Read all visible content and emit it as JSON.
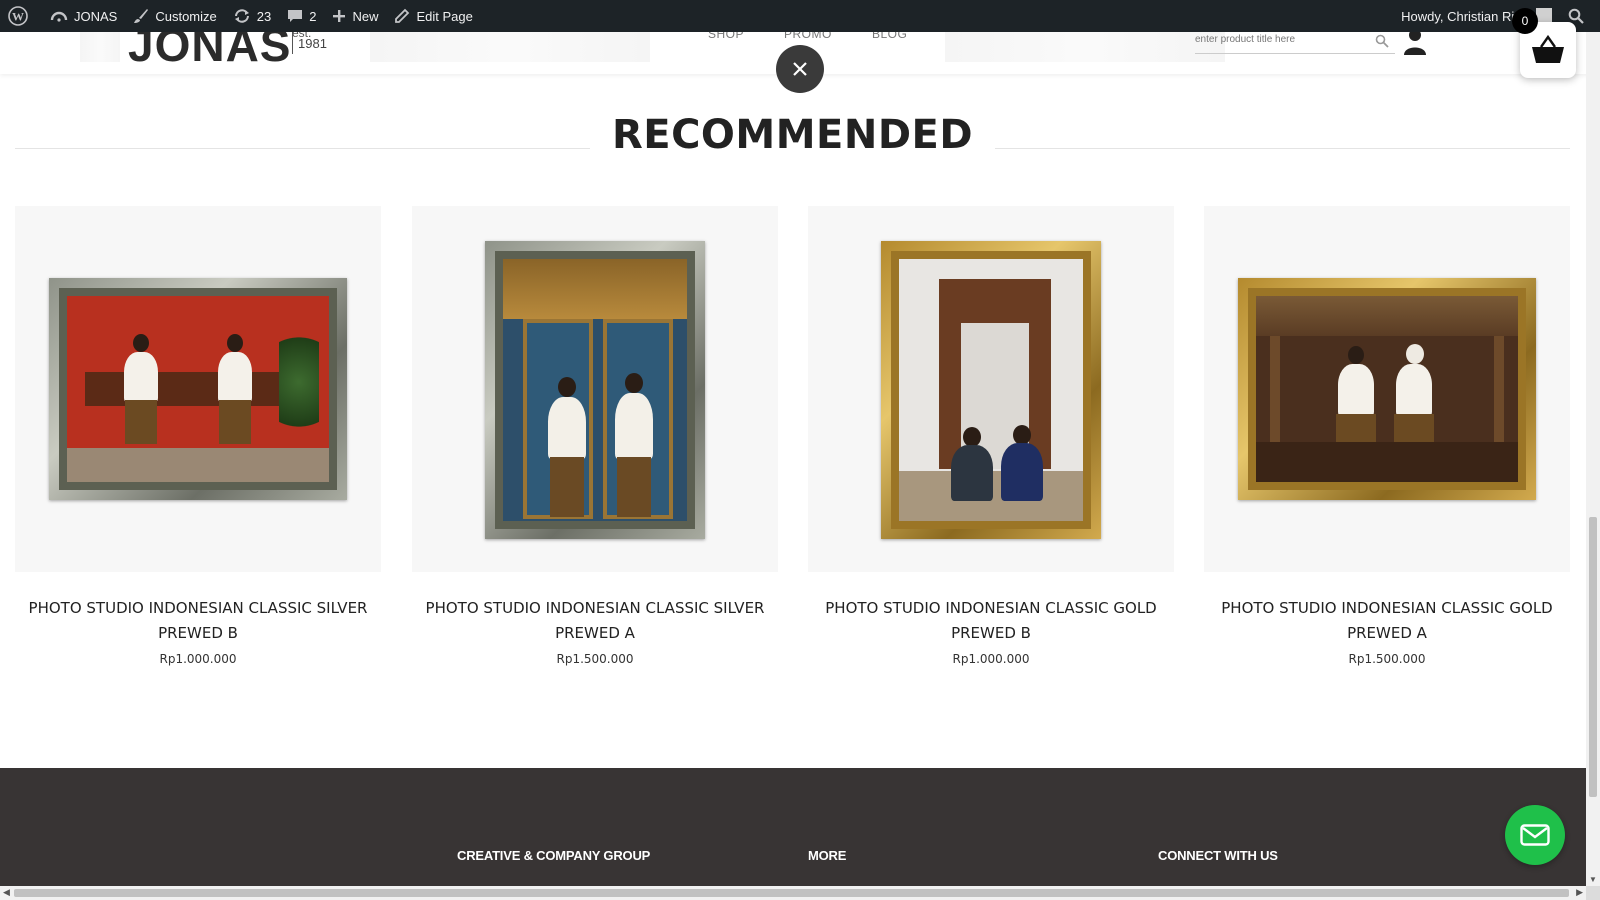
{
  "adminbar": {
    "site_name": "JONAS",
    "customize": "Customize",
    "updates_count": "23",
    "comments_count": "2",
    "new_label": "New",
    "edit_page": "Edit Page",
    "howdy": "Howdy, Christian Riza"
  },
  "header": {
    "logo_text": "JONAS",
    "logo_est": "est.",
    "logo_year": "1981",
    "nav": [
      "SHOP",
      "PROMO",
      "BLOG"
    ],
    "search_placeholder": "enter product title here"
  },
  "cart": {
    "count": "0"
  },
  "recommended": {
    "title": "RECOMMENDED",
    "products": [
      {
        "name": "PHOTO STUDIO INDONESIAN CLASSIC SILVER PREWED B",
        "price": "Rp1.000.000",
        "frame": "silver",
        "orientation": "landscape"
      },
      {
        "name": "PHOTO STUDIO INDONESIAN CLASSIC SILVER PREWED A",
        "price": "Rp1.500.000",
        "frame": "silver",
        "orientation": "portrait"
      },
      {
        "name": "PHOTO STUDIO INDONESIAN CLASSIC GOLD PREWED B",
        "price": "Rp1.000.000",
        "frame": "gold",
        "orientation": "portrait"
      },
      {
        "name": "PHOTO STUDIO INDONESIAN CLASSIC GOLD PREWED A",
        "price": "Rp1.500.000",
        "frame": "gold",
        "orientation": "landscape"
      }
    ]
  },
  "footer": {
    "columns": [
      "CREATIVE & COMPANY GROUP",
      "MORE",
      "CONNECT WITH US"
    ]
  },
  "colors": {
    "adminbar_bg": "#1d2327",
    "footer_bg": "#383434",
    "mail_button": "#1fc04a",
    "close_button": "#3a3a3a"
  },
  "icons": [
    "wordpress-icon",
    "palette-icon",
    "update-icon",
    "comment-icon",
    "plus-icon",
    "pencil-icon",
    "search-icon",
    "user-icon",
    "basket-icon",
    "close-icon",
    "mail-icon"
  ]
}
